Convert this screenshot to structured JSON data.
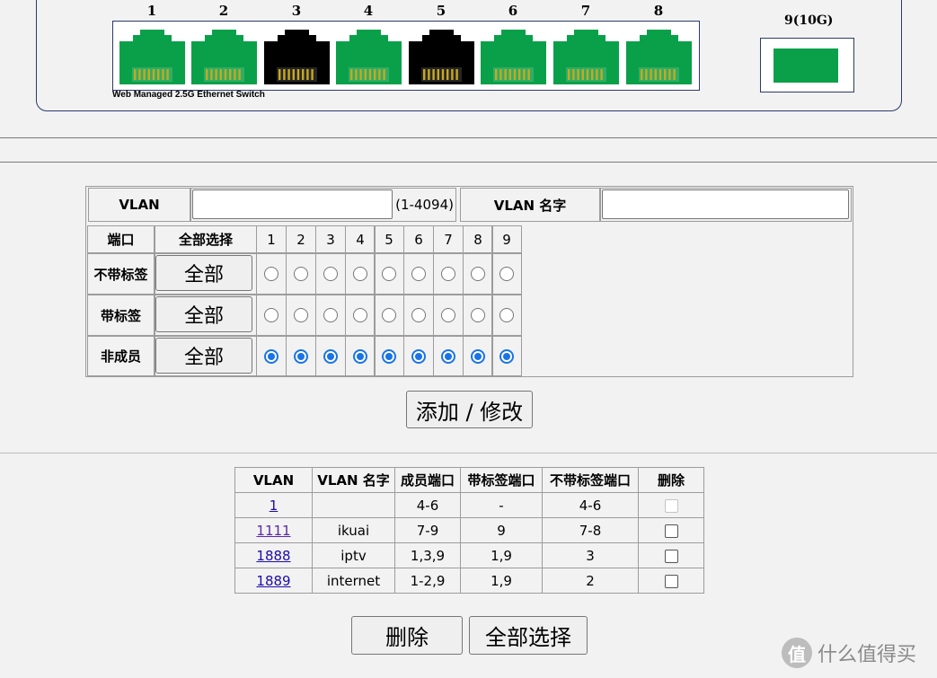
{
  "switch": {
    "port_numbers": [
      "1",
      "2",
      "3",
      "4",
      "5",
      "6",
      "7",
      "8"
    ],
    "port_states": [
      "green",
      "green",
      "black",
      "green",
      "black",
      "green",
      "green",
      "green"
    ],
    "caption": "Web Managed 2.5G Ethernet Switch",
    "sfp_label": "9(10G)",
    "colors": {
      "active": "#0aa04a",
      "inactive": "#000000",
      "pins": "#c8a820"
    }
  },
  "form": {
    "vlan_label": "VLAN",
    "vlan_value": "",
    "vlan_range": "(1-4094)",
    "name_label": "VLAN 名字",
    "name_value": "",
    "port_header": "端口",
    "select_all_header": "全部选择",
    "ports": [
      "1",
      "2",
      "3",
      "4",
      "5",
      "6",
      "7",
      "8",
      "9"
    ],
    "rows": [
      {
        "label": "不带标签",
        "button": "全部",
        "selected": false
      },
      {
        "label": "带标签",
        "button": "全部",
        "selected": false
      },
      {
        "label": "非成员",
        "button": "全部",
        "selected": true
      }
    ],
    "submit_label": "添加 / 修改"
  },
  "vlan_table": {
    "headers": [
      "VLAN",
      "VLAN 名字",
      "成员端口",
      "带标签端口",
      "不带标签端口",
      "删除"
    ],
    "rows": [
      {
        "vlan": "1",
        "name": "",
        "members": "4-6",
        "tagged": "-",
        "untagged": "4-6",
        "deletable": false
      },
      {
        "vlan": "1111",
        "name": "ikuai",
        "members": "7-9",
        "tagged": "9",
        "untagged": "7-8",
        "deletable": true
      },
      {
        "vlan": "1888",
        "name": "iptv",
        "members": "1,3,9",
        "tagged": "1,9",
        "untagged": "3",
        "deletable": true
      },
      {
        "vlan": "1889",
        "name": "internet",
        "members": "1-2,9",
        "tagged": "1,9",
        "untagged": "2",
        "deletable": true
      }
    ],
    "delete_label": "删除",
    "select_all_label": "全部选择"
  },
  "watermark": {
    "logo": "值",
    "text": "什么值得买"
  }
}
